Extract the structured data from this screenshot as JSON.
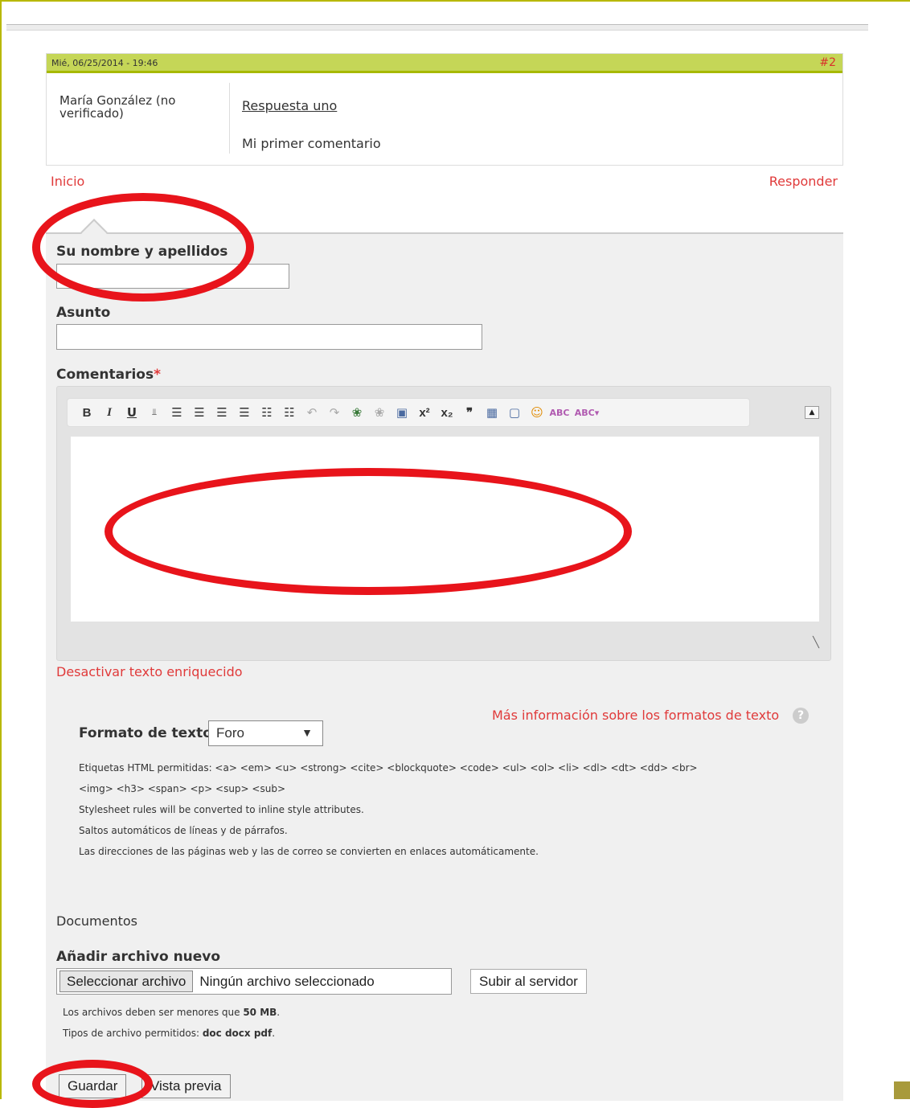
{
  "comment": {
    "date": "Mié, 06/25/2014 - 19:46",
    "number": "#2",
    "author": "María González (no verificado)",
    "subject": "Respuesta uno",
    "body": "Mi primer comentario"
  },
  "links": {
    "home": "Inicio",
    "reply": "Responder"
  },
  "form": {
    "name_label": "Su nombre y apellidos",
    "subject_label": "Asunto",
    "comment_label": "Comentarios",
    "required_mark": "*",
    "disable_rich": "Desactivar texto enriquecido",
    "more_info": "Más información sobre los formatos de texto",
    "format_label": "Formato de texto",
    "format_value": "Foro",
    "tips": [
      "Etiquetas HTML permitidas: <a> <em> <u> <strong> <cite> <blockquote> <code> <ul> <ol> <li> <dl> <dt> <dd> <br>",
      "<img> <h3> <span> <p> <sup> <sub>",
      "Stylesheet rules will be converted to inline style attributes.",
      "Saltos automáticos de líneas y de párrafos.",
      "Las direcciones de las páginas web y las de correo se convierten en enlaces automáticamente."
    ],
    "documents_title": "Documentos",
    "add_file_label": "Añadir archivo nuevo",
    "choose_file_button": "Seleccionar archivo",
    "no_file_text": "Ningún archivo seleccionado",
    "upload_button": "Subir al servidor",
    "size_note_prefix": "Los archivos deben ser menores que",
    "size_note_value": "50 MB",
    "size_note_suffix": ".",
    "types_note_prefix": "Tipos de archivo permitidos:",
    "types_note_value": "doc docx pdf",
    "types_note_suffix": ".",
    "save_button": "Guardar",
    "preview_button": "Vista previa"
  },
  "toolbar": {
    "bold": "B",
    "italic": "I",
    "underline": "U",
    "superscript": "x²",
    "subscript": "x₂",
    "quote": "❞"
  },
  "colors": {
    "accent_red": "#e03a3a",
    "header_green": "#c5d657",
    "annotation_red": "#e8141b"
  }
}
